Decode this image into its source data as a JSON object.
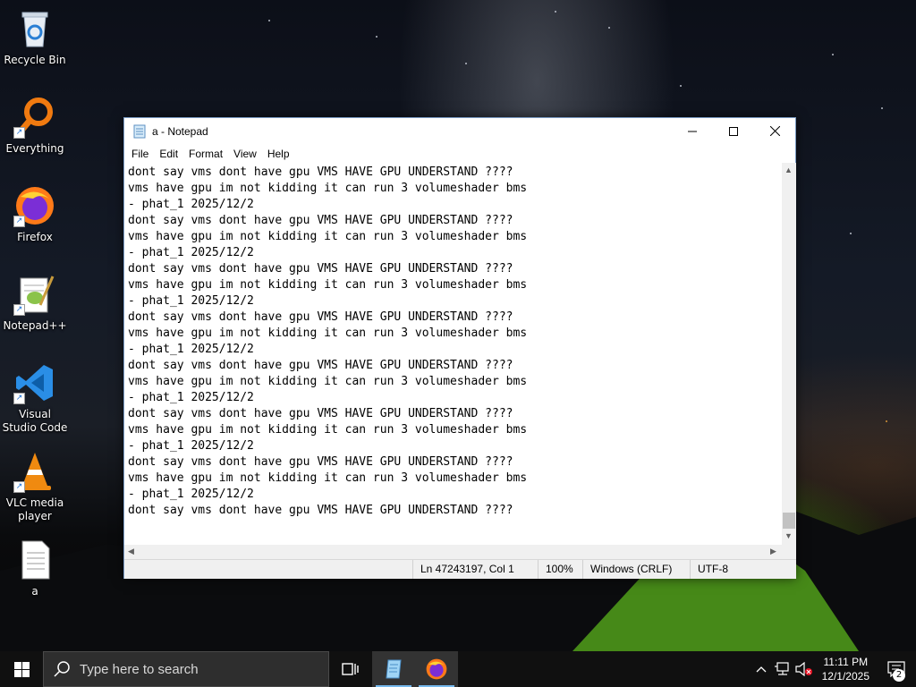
{
  "desktop": {
    "icons": [
      {
        "label": "Recycle Bin"
      },
      {
        "label": "Everything"
      },
      {
        "label": "Firefox"
      },
      {
        "label": "Notepad++"
      },
      {
        "label": "Visual Studio Code"
      },
      {
        "label": "VLC media player"
      },
      {
        "label": "a"
      }
    ]
  },
  "notepad": {
    "title": "a - Notepad",
    "menu": [
      "File",
      "Edit",
      "Format",
      "View",
      "Help"
    ],
    "lines": [
      "dont say vms dont have gpu VMS HAVE GPU UNDERSTAND ????",
      "vms have gpu im not kidding it can run 3 volumeshader bms",
      "- phat_1 2025/12/2",
      "dont say vms dont have gpu VMS HAVE GPU UNDERSTAND ????",
      "vms have gpu im not kidding it can run 3 volumeshader bms",
      "- phat_1 2025/12/2",
      "dont say vms dont have gpu VMS HAVE GPU UNDERSTAND ????",
      "vms have gpu im not kidding it can run 3 volumeshader bms",
      "- phat_1 2025/12/2",
      "dont say vms dont have gpu VMS HAVE GPU UNDERSTAND ????",
      "vms have gpu im not kidding it can run 3 volumeshader bms",
      "- phat_1 2025/12/2",
      "dont say vms dont have gpu VMS HAVE GPU UNDERSTAND ????",
      "vms have gpu im not kidding it can run 3 volumeshader bms",
      "- phat_1 2025/12/2",
      "dont say vms dont have gpu VMS HAVE GPU UNDERSTAND ????",
      "vms have gpu im not kidding it can run 3 volumeshader bms",
      "- phat_1 2025/12/2",
      "dont say vms dont have gpu VMS HAVE GPU UNDERSTAND ????",
      "vms have gpu im not kidding it can run 3 volumeshader bms",
      "- phat_1 2025/12/2",
      "dont say vms dont have gpu VMS HAVE GPU UNDERSTAND ????"
    ],
    "status": {
      "position": "Ln 47243197, Col 1",
      "zoom": "100%",
      "line_ending": "Windows (CRLF)",
      "encoding": "UTF-8"
    }
  },
  "taskbar": {
    "search_placeholder": "Type here to search",
    "time": "11:11 PM",
    "date": "12/1/2025",
    "notification_count": "2"
  },
  "colors": {
    "accent": "#76b9ed",
    "taskbar_bg": "#101010",
    "vscode_blue": "#2a8ee6",
    "vlc_orange": "#f08a10",
    "everything_orange": "#f07a10"
  }
}
